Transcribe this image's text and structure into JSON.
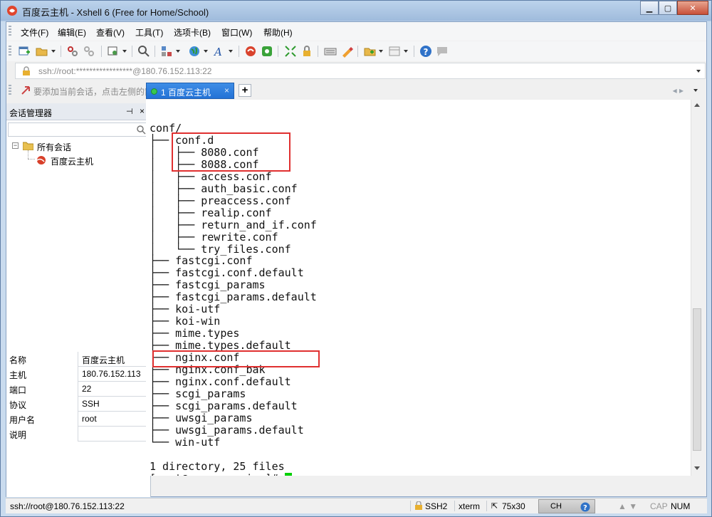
{
  "window": {
    "title": "百度云主机 - Xshell 6 (Free for Home/School)",
    "minimize": "▁",
    "maximize": "▢",
    "close": "✕"
  },
  "menu": [
    "文件(F)",
    "编辑(E)",
    "查看(V)",
    "工具(T)",
    "选项卡(B)",
    "窗口(W)",
    "帮助(H)"
  ],
  "address": {
    "value": "ssh://root:*****************@180.76.152.113:22"
  },
  "hint": "要添加当前会话，点击左侧的箭头按钮。",
  "session_manager": {
    "title": "会话管理器",
    "pin": "⊣",
    "close": "×",
    "tree": {
      "root_label": "所有会话",
      "toggle": "−",
      "child_label": "百度云主机"
    },
    "properties": [
      {
        "key": "名称",
        "value": "百度云主机"
      },
      {
        "key": "主机",
        "value": "180.76.152.113"
      },
      {
        "key": "端口",
        "value": "22"
      },
      {
        "key": "协议",
        "value": "SSH"
      },
      {
        "key": "用户名",
        "value": "root"
      },
      {
        "key": "说明",
        "value": ""
      }
    ]
  },
  "tabs": {
    "active_label": "1 百度云主机",
    "close": "×",
    "add": "+",
    "nav": "◂ ▸"
  },
  "terminal": {
    "lines": [
      "conf/",
      "├── conf.d",
      "│   ├── 8080.conf",
      "│   ├── 8088.conf",
      "│   ├── access.conf",
      "│   ├── auth_basic.conf",
      "│   ├── preaccess.conf",
      "│   ├── realip.conf",
      "│   ├── return_and_if.conf",
      "│   ├── rewrite.conf",
      "│   └── try_files.conf",
      "├── fastcgi.conf",
      "├── fastcgi.conf.default",
      "├── fastcgi_params",
      "├── fastcgi_params.default",
      "├── koi-utf",
      "├── koi-win",
      "├── mime.types",
      "├── mime.types.default",
      "├── nginx.conf",
      "├── nginx.conf_bak",
      "├── nginx.conf.default",
      "├── scgi_params",
      "├── scgi_params.default",
      "├── uwsgi_params",
      "├── uwsgi_params.default",
      "└── win-utf",
      "",
      "1 directory, 25 files",
      "[root@server nginx]# "
    ]
  },
  "status": {
    "connection": "ssh://root@180.76.152.113:22",
    "protocol": "SSH2",
    "term": "xterm",
    "size": "75x30",
    "ime": "CH",
    "caps": "CAP",
    "num": "NUM"
  },
  "colors": {
    "highlight_box": "#e03030",
    "cursor": "#00d000",
    "tab_active": "#2372d6"
  }
}
